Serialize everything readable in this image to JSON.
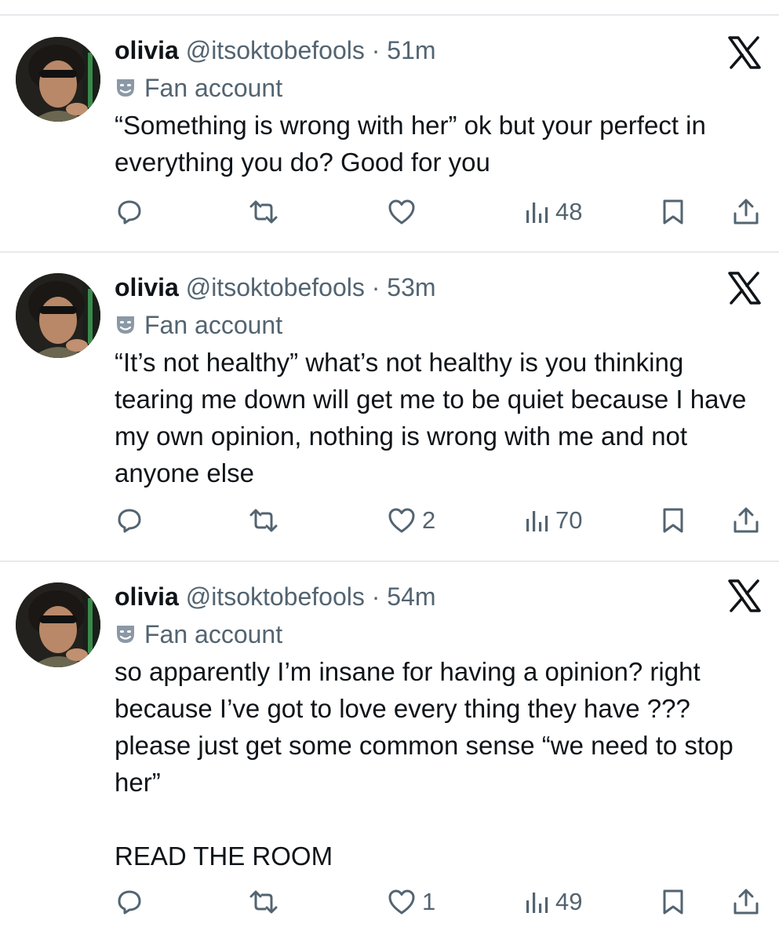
{
  "tweets": [
    {
      "display_name": "olivia",
      "handle": "@itsoktobefools",
      "time": "51m",
      "badge": "Fan account",
      "text": [
        "“Something is wrong with her” ok but your perfect in everything you do? Good for you"
      ],
      "likes": "",
      "views": "48"
    },
    {
      "display_name": "olivia",
      "handle": "@itsoktobefools",
      "time": "53m",
      "badge": "Fan account",
      "text": [
        "“It’s not healthy” what’s not healthy is you thinking tearing me down will get me to be quiet because I have my own opinion, nothing is wrong with me and not anyone else"
      ],
      "likes": "2",
      "views": "70"
    },
    {
      "display_name": "olivia",
      "handle": "@itsoktobefools",
      "time": "54m",
      "badge": "Fan account",
      "text": [
        "so apparently I’m insane for having a opinion? right because I’ve got to love every thing they have ??? please just get some common sense “we need to stop her”",
        "READ THE ROOM"
      ],
      "likes": "1",
      "views": "49"
    }
  ],
  "icons": {
    "reply": "reply-icon",
    "retweet": "retweet-icon",
    "like": "heart-icon",
    "views": "views-icon",
    "bookmark": "bookmark-icon",
    "share": "share-icon",
    "close": "x-logo-icon",
    "badge": "theater-mask-icon"
  },
  "colors": {
    "text": "#0f1419",
    "secondary": "#536471",
    "divider": "#e7e9ec"
  }
}
